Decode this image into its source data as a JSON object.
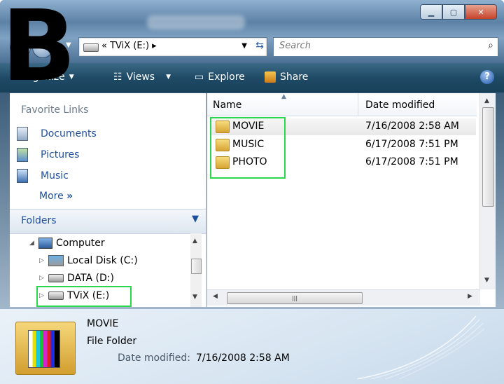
{
  "overlay_letter": "B",
  "address": {
    "path": "«  TViX (E:)  ▸"
  },
  "search": {
    "placeholder": "Search"
  },
  "toolbar": {
    "organize": "Organize",
    "views": "Views",
    "explore": "Explore",
    "share": "Share",
    "help": "?"
  },
  "favorites": {
    "header": "Favorite Links",
    "items": [
      "Documents",
      "Pictures",
      "Music"
    ],
    "more": "More"
  },
  "folders": {
    "header": "Folders",
    "tree": [
      {
        "label": "Computer"
      },
      {
        "label": "Local Disk (C:)"
      },
      {
        "label": "DATA (D:)"
      },
      {
        "label": "TViX (E:)"
      }
    ]
  },
  "list": {
    "columns": [
      "Name",
      "Date modified"
    ],
    "rows": [
      {
        "name": "MOVIE",
        "date": "7/16/2008 2:58 AM"
      },
      {
        "name": "MUSIC",
        "date": "6/17/2008 7:51 PM"
      },
      {
        "name": "PHOTO",
        "date": "6/17/2008 7:51 PM"
      }
    ]
  },
  "details": {
    "name": "MOVIE",
    "type": "File Folder",
    "modified_label": "Date modified:",
    "modified": "7/16/2008 2:58 AM"
  }
}
